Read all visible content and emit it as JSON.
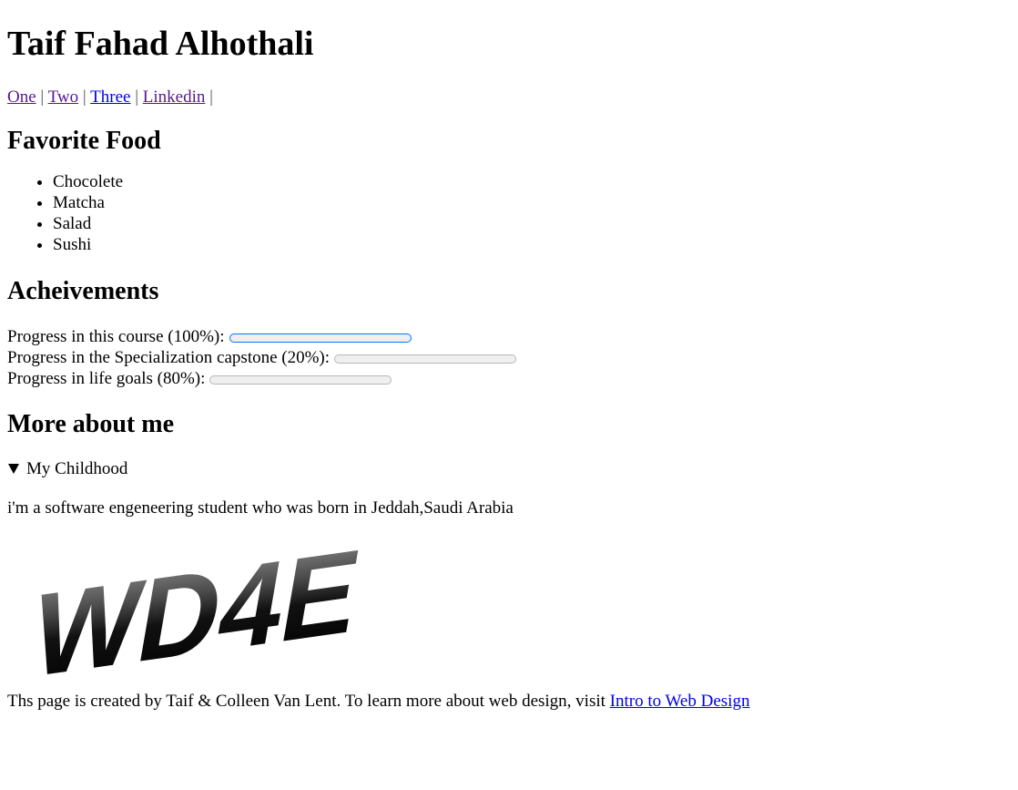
{
  "header": {
    "title": "Taif Fahad Alhothali"
  },
  "nav": {
    "links": [
      {
        "label": "One"
      },
      {
        "label": "Two"
      },
      {
        "label": "Three"
      },
      {
        "label": "Linkedin"
      }
    ],
    "separator": "|"
  },
  "food": {
    "heading": "Favorite Food",
    "items": [
      "Chocolete",
      "Matcha",
      "Salad",
      "Sushi"
    ]
  },
  "achievements": {
    "heading": "Acheivements",
    "progress": [
      {
        "label": "Progress in this course (100%):",
        "value": 1.0
      },
      {
        "label": "Progress in the Specialization capstone (20%):",
        "value": 0.2
      },
      {
        "label": "Progress in life goals (80%):",
        "value": 0.8
      }
    ],
    "accent_color": "#0075ff"
  },
  "more": {
    "heading": "More about me",
    "summary": "My Childhood",
    "text": "i'm a software engeneering student who was born in Jeddah,Saudi Arabia"
  },
  "logo": {
    "text": "WD4E"
  },
  "footer": {
    "text": "Ths page is created by Taif & Colleen Van Lent. To learn more about web design, visit ",
    "link_label": "Intro to Web Design"
  }
}
